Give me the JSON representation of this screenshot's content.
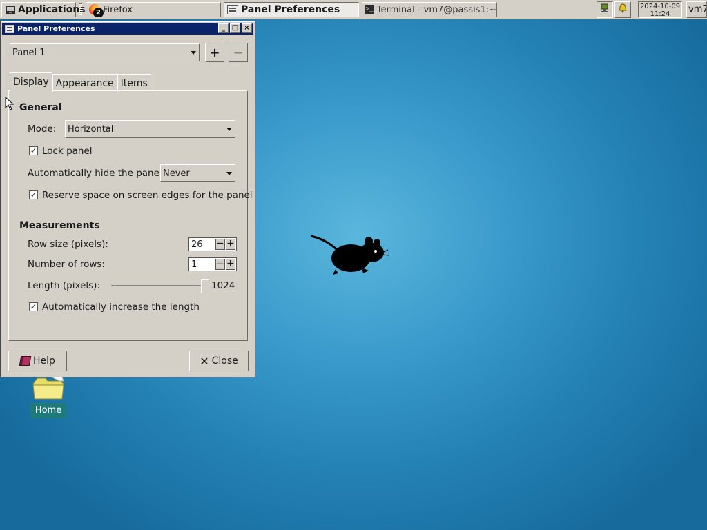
{
  "panel": {
    "applications_label": "Applications",
    "tasks": [
      {
        "label": "Firefox",
        "badge": "2"
      },
      {
        "label": "Panel Preferences"
      },
      {
        "label": "Terminal - vm7@passis1:~"
      }
    ],
    "clock": {
      "date": "2024-10-09",
      "time": "11:24"
    },
    "user": "vm7"
  },
  "window": {
    "title": "Panel Preferences",
    "panel_select": "Panel 1",
    "add_symbol": "+",
    "remove_symbol": "−",
    "tabs": [
      "Display",
      "Appearance",
      "Items"
    ],
    "general": {
      "heading": "General",
      "mode_label": "Mode:",
      "mode_value": "Horizontal",
      "lock_panel_label": "Lock panel",
      "lock_panel_checked": true,
      "autohide_label": "Automatically hide the panel:",
      "autohide_value": "Never",
      "reserve_space_label": "Reserve space on screen edges for the panel",
      "reserve_space_checked": true
    },
    "measurements": {
      "heading": "Measurements",
      "row_size_label": "Row size (pixels):",
      "row_size_value": "26",
      "rows_label": "Number of rows:",
      "rows_value": "1",
      "length_label": "Length (pixels):",
      "length_value": "1024",
      "auto_length_label": "Automatically increase the length",
      "auto_length_checked": true
    },
    "help_label": "Help",
    "close_label": "Close"
  },
  "desktop": {
    "home_label": "Home"
  },
  "colors": {
    "panel_bg": "#d4d0c8",
    "titlebar": "#0a246a",
    "desktop": "#2a8cc0",
    "home_label_bg": "#1f7a7c"
  }
}
